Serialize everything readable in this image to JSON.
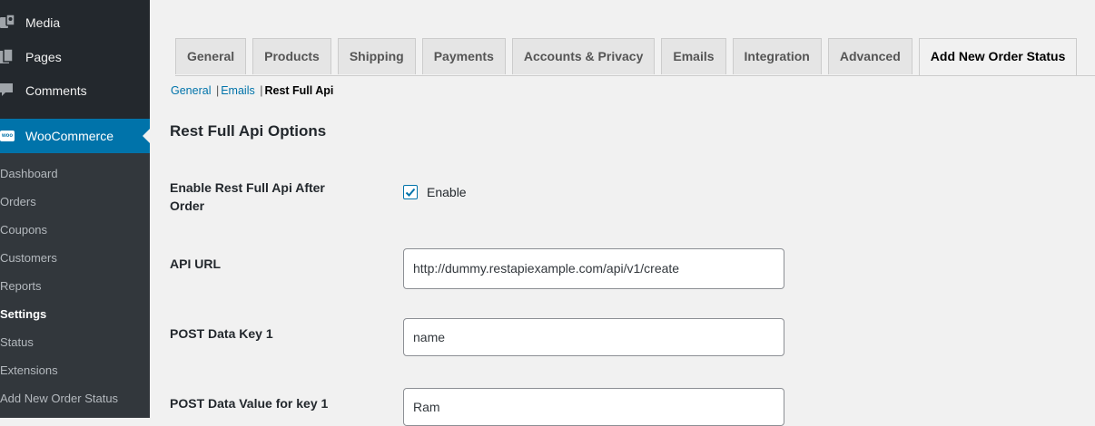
{
  "sidebar": {
    "menu": [
      {
        "label": "Media",
        "icon": "media-icon"
      },
      {
        "label": "Pages",
        "icon": "pages-icon"
      },
      {
        "label": "Comments",
        "icon": "comments-icon"
      }
    ],
    "woocommerce": {
      "label": "WooCommerce",
      "icon": "woocommerce-icon",
      "icon_text": "woo"
    },
    "submenu": [
      "Dashboard",
      "Orders",
      "Coupons",
      "Customers",
      "Reports",
      "Settings",
      "Status",
      "Extensions",
      "Add New Order Status"
    ],
    "current_submenu": "Settings"
  },
  "tabs": [
    "General",
    "Products",
    "Shipping",
    "Payments",
    "Accounts & Privacy",
    "Emails",
    "Integration",
    "Advanced",
    "Add New Order Status"
  ],
  "active_tab": "Add New Order Status",
  "subnav": {
    "links": [
      "General",
      "Emails"
    ],
    "current": "Rest Full Api",
    "separator": "|"
  },
  "section_title": "Rest Full Api Options",
  "fields": {
    "enable": {
      "label": "Enable Rest Full Api After Order",
      "checkbox_label": "Enable",
      "checked": true
    },
    "api_url": {
      "label": "API URL",
      "value": "http://dummy.restapiexample.com/api/v1/create"
    },
    "post_key_1": {
      "label": "POST Data Key 1",
      "value": "name"
    },
    "post_value_1": {
      "label": "POST Data Value for key 1",
      "value": "Ram"
    }
  },
  "colors": {
    "sidebar_bg": "#23282d",
    "submenu_bg": "#32373c",
    "accent": "#0073aa"
  }
}
